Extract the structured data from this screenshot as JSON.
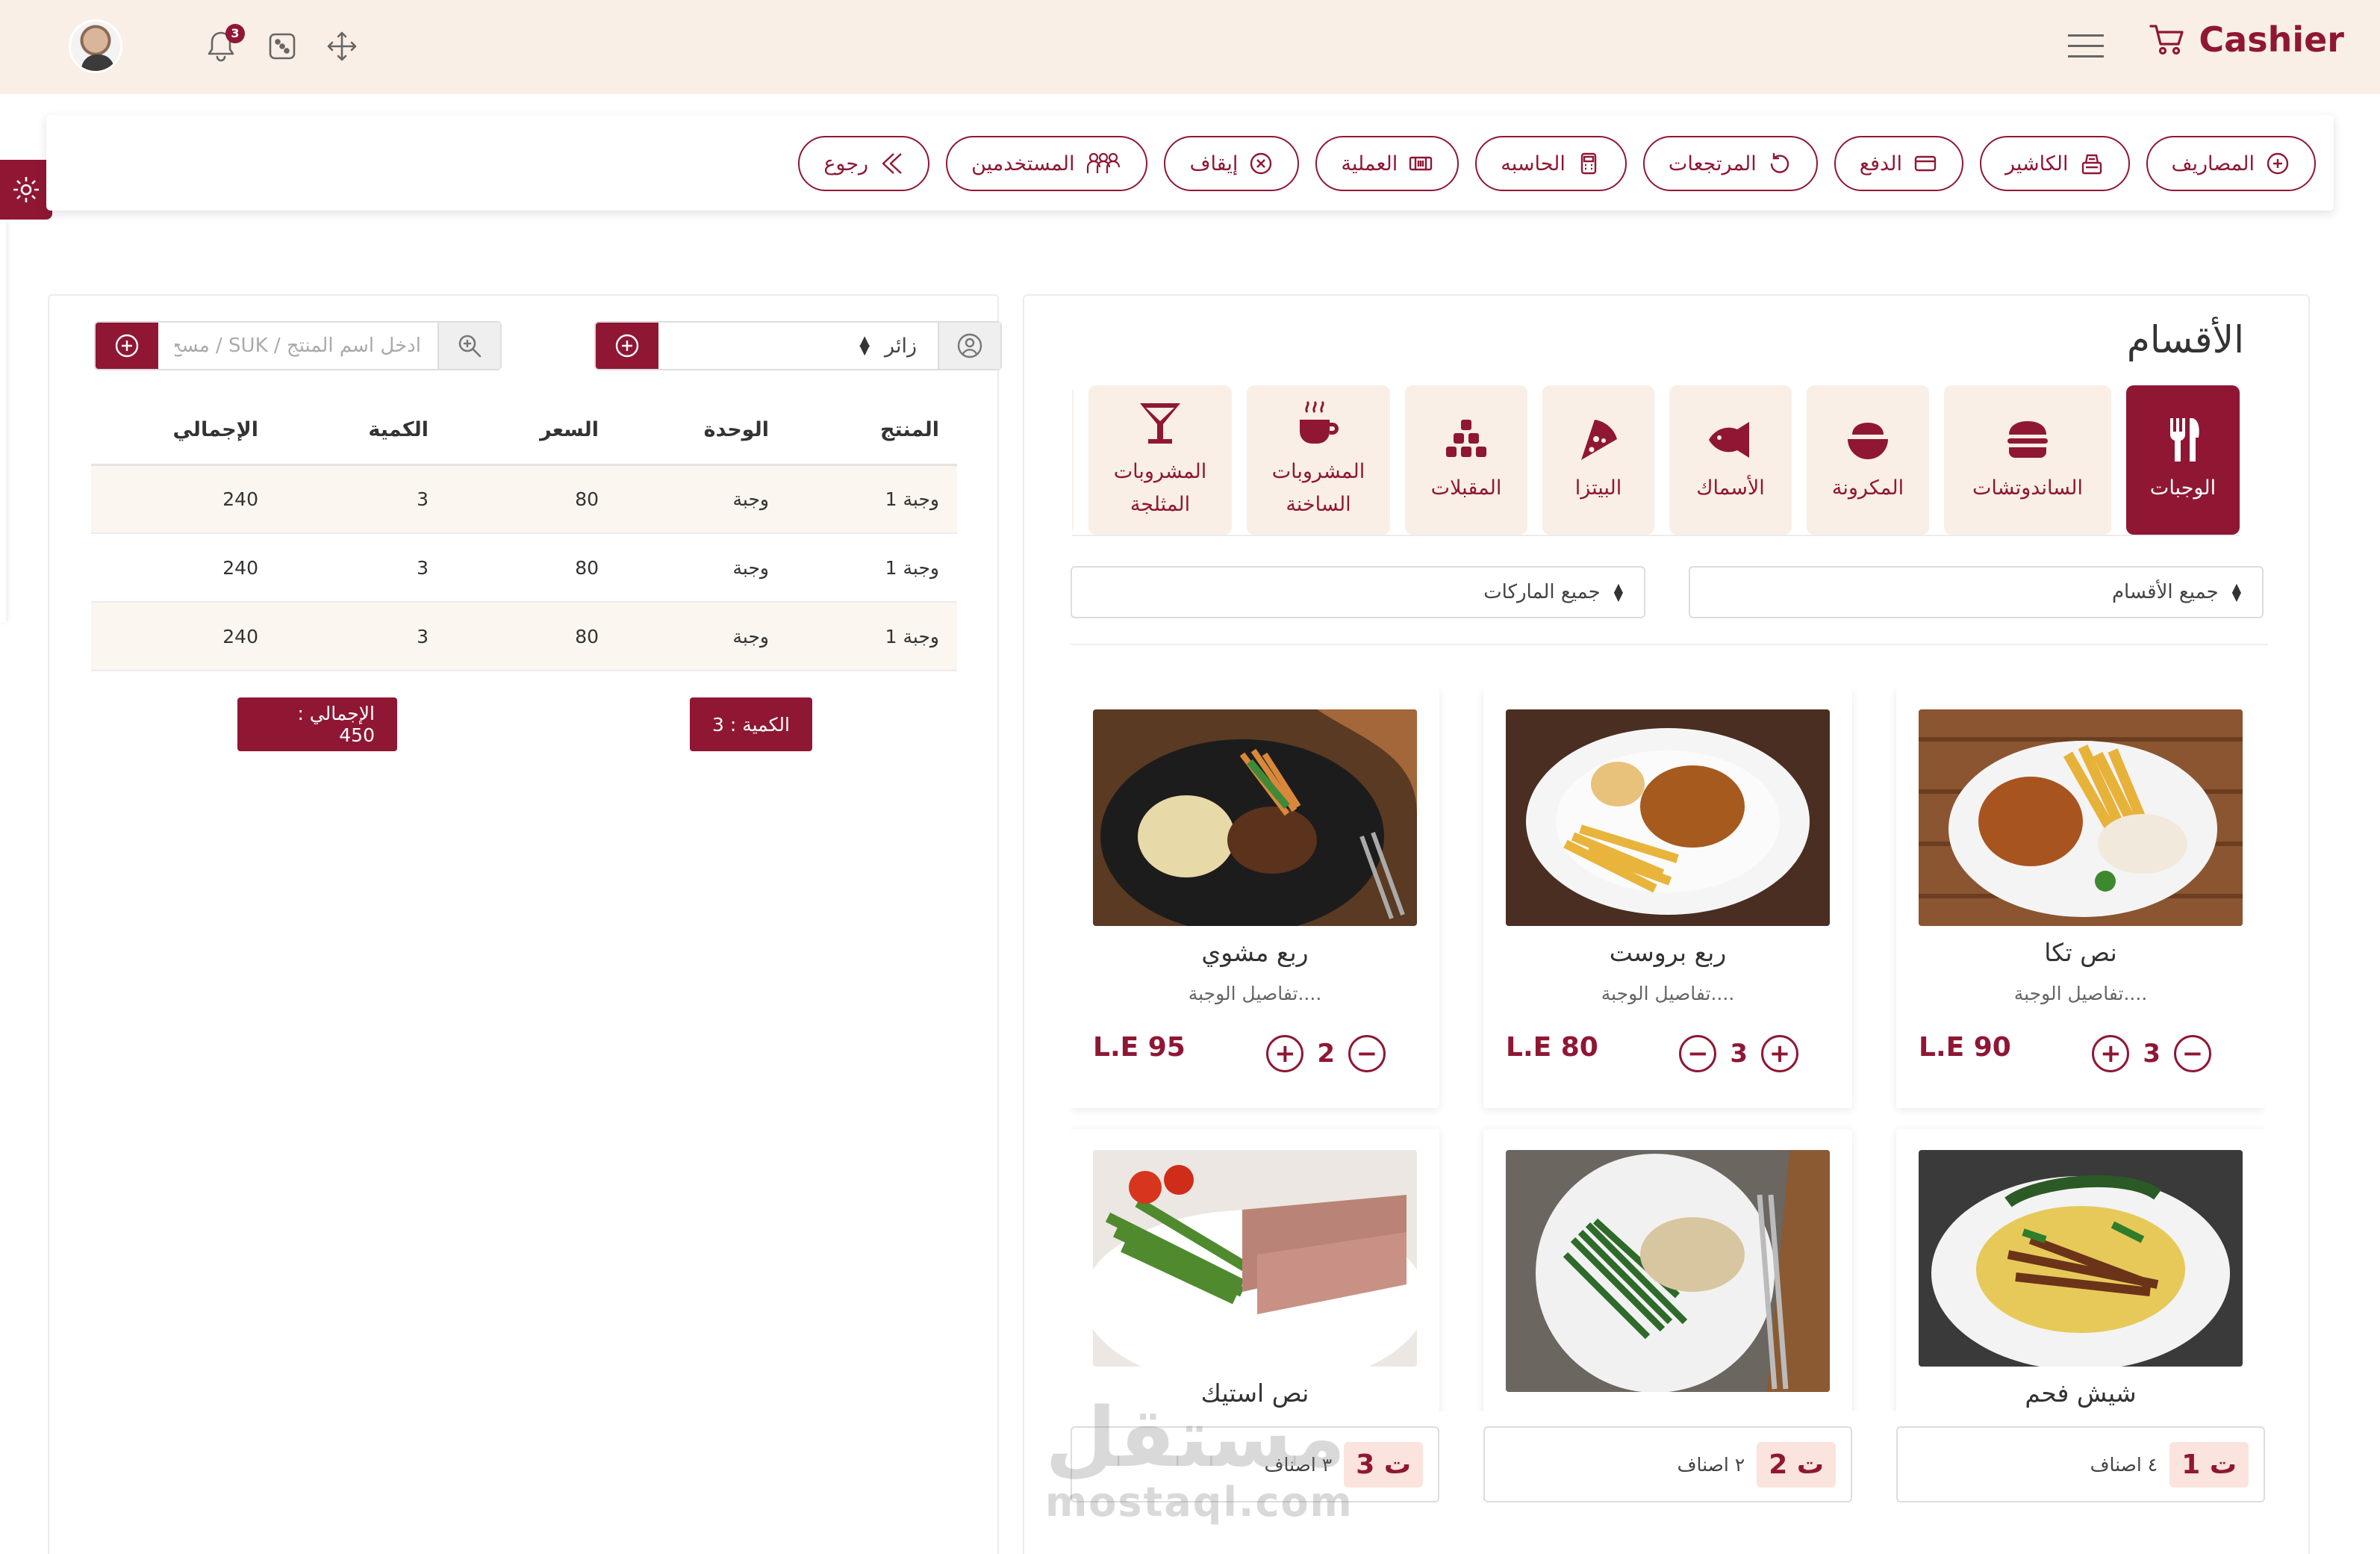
{
  "header": {
    "brand": "Cashier",
    "notifications_count": "3"
  },
  "actions": [
    {
      "label": "المصاريف",
      "icon": "plus-circle-icon"
    },
    {
      "label": "الكاشير",
      "icon": "register-icon"
    },
    {
      "label": "الدفع",
      "icon": "card-icon"
    },
    {
      "label": "المرتجعات",
      "icon": "undo-icon"
    },
    {
      "label": "الحاسبه",
      "icon": "calculator-icon"
    },
    {
      "label": "العملية",
      "icon": "ticket-icon"
    },
    {
      "label": "إيقاف",
      "icon": "x-circle-icon"
    },
    {
      "label": "المستخدمين",
      "icon": "users-icon"
    },
    {
      "label": "رجوع",
      "icon": "back-arrow-icon"
    }
  ],
  "cart": {
    "customer_value": "زائر",
    "product_placeholder": "ادخل اسم المنتج / SUK / مسح",
    "columns": [
      "المنتج",
      "الوحدة",
      "السعر",
      "الكمية",
      "الإجمالي"
    ],
    "rows": [
      [
        "وجبة 1",
        "وجبة",
        "80",
        "3",
        "240"
      ],
      [
        "وجبة 1",
        "وجبة",
        "80",
        "3",
        "240"
      ],
      [
        "وجبة 1",
        "وجبة",
        "80",
        "3",
        "240"
      ]
    ],
    "qty_summary": "الكمية : 3",
    "total_summary": "الإجمالي : 450"
  },
  "menu": {
    "title": "الأقسام",
    "categories": [
      {
        "label": "الوجبات",
        "icon": "fork-knife-icon",
        "active": true
      },
      {
        "label": "الساندوتشات",
        "icon": "burger-icon",
        "active": false
      },
      {
        "label": "المكرونة",
        "icon": "bowl-icon",
        "active": false
      },
      {
        "label": "الأسماك",
        "icon": "fish-icon",
        "active": false
      },
      {
        "label": "البيتزا",
        "icon": "pizza-icon",
        "active": false
      },
      {
        "label": "المقبلات",
        "icon": "appetizer-icon",
        "active": false
      },
      {
        "label": "المشروبات الساخنة",
        "icon": "hot-drink-icon",
        "active": false
      },
      {
        "label": "المشروبات المثلجة",
        "icon": "cocktail-icon",
        "active": false
      }
    ],
    "filter_categories": "جميع الأقسام",
    "filter_brands": "جميع الماركات",
    "products": [
      {
        "name": "نص تكا",
        "desc": "تفاصيل الوجبة....",
        "price": "L.E 90",
        "qty": "3"
      },
      {
        "name": "ربع بروست",
        "desc": "تفاصيل الوجبة....",
        "price": "L.E 80",
        "qty": "3"
      },
      {
        "name": "ربع مشوي",
        "desc": "تفاصيل الوجبة....",
        "price": "L.E 95",
        "qty": "2"
      },
      {
        "name": "شيش فحم",
        "desc": "",
        "price": "",
        "qty": ""
      },
      {
        "name": "",
        "desc": "",
        "price": "",
        "qty": ""
      },
      {
        "name": "نص استيك",
        "desc": "",
        "price": "",
        "qty": ""
      }
    ],
    "tickets": [
      {
        "badge": "ت 1",
        "label": "٤ اصناف"
      },
      {
        "badge": "ت 2",
        "label": "٢ اصناف"
      },
      {
        "badge": "ت 3",
        "label": "٣ اصناف"
      }
    ]
  },
  "watermark": {
    "arabic": "مستقل",
    "latin": "mostaql.com"
  },
  "colors": {
    "accent": "#8f1734",
    "topbar": "#f9efe6",
    "category_bg": "#f9efe6",
    "row_alt": "#fbf6ef"
  }
}
